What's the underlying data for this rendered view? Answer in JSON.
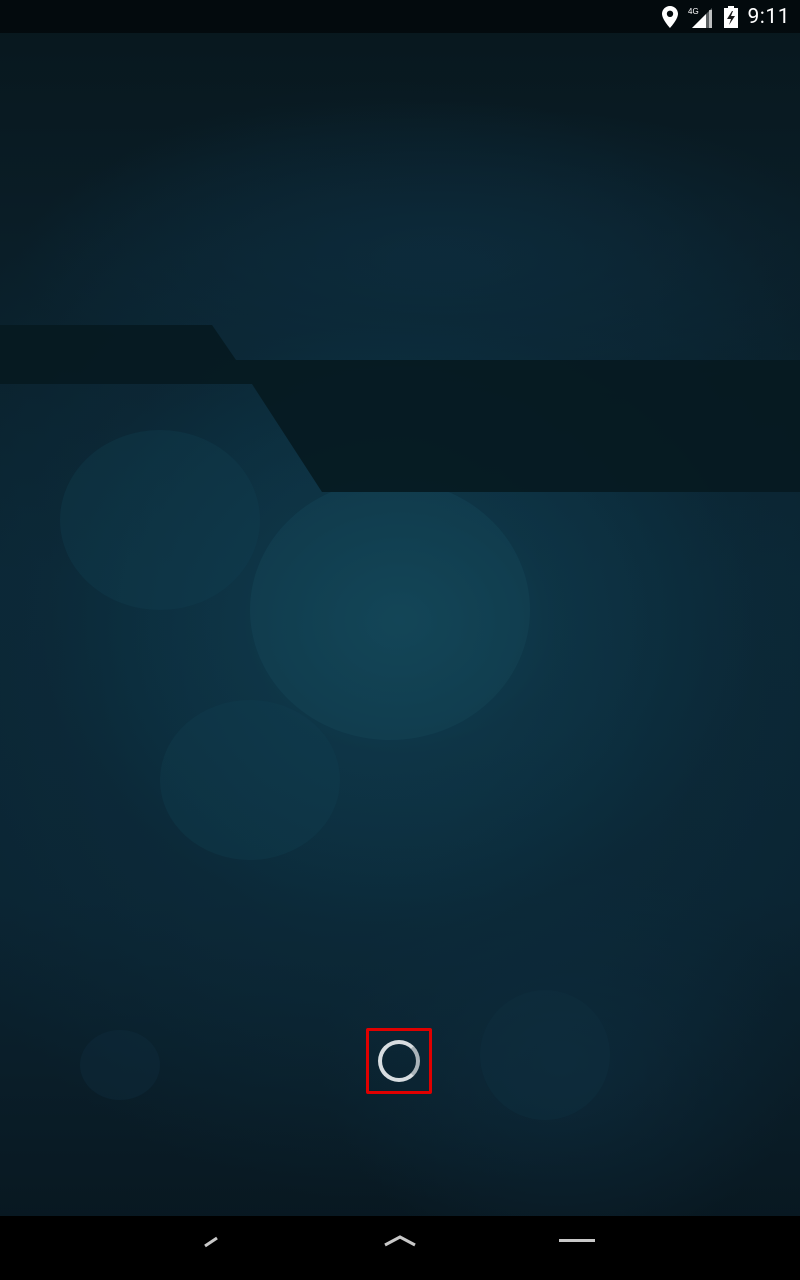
{
  "status_bar": {
    "time": "9:11",
    "network_label": "4G",
    "icons": [
      "location-icon",
      "signal-icon",
      "battery-charging-icon"
    ]
  },
  "loading": {
    "indicator": "spinner",
    "highlight_color": "#e00000"
  },
  "nav_bar": {
    "buttons": [
      "back-icon",
      "home-icon",
      "recents-icon"
    ]
  },
  "colors": {
    "wallpaper_dark": "#08171d",
    "wallpaper_mid": "#0b2634",
    "band": "#051a20",
    "navbar": "#000000"
  }
}
